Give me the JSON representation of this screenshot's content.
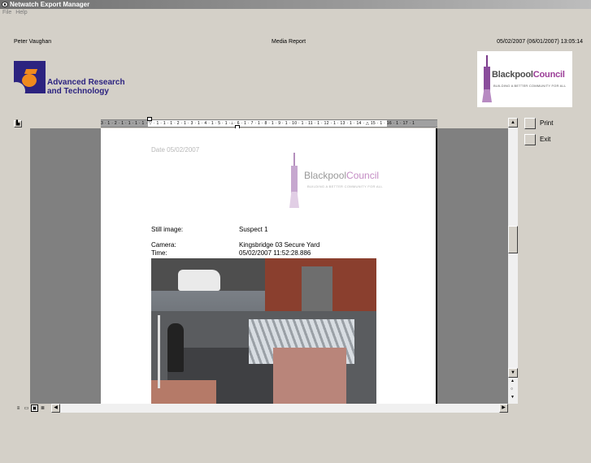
{
  "window": {
    "title": "Netwatch Export Manager"
  },
  "menu": {
    "file": "File",
    "help": "Help"
  },
  "header": {
    "user": "Peter Vaughan",
    "report_title": "Media Report",
    "datetime": "05/02/2007 (06/01/2007) 13:05:14"
  },
  "logos": {
    "art_line1": "Advanced Research",
    "art_line2": "and Technology",
    "council_name": "Blackpool",
    "council_word": "Council",
    "council_tagline": "BUILDING A BETTER COMMUNITY FOR ALL"
  },
  "ruler": {
    "marks": "3 · 1 · 2 · 1 · 1 · 1 · 1 · ▽ · 1 · 1 · 1 · 2 · 1 · 3 · 1 · 4 · 1 · 5 · 1 ·⊥· 6 · 1 · 7 · 1 · 8 · 1 · 9 · 1 · 10 · 1 · 11 · 1 · 12 · 1 · 13 · 1 · 14 · △ 15 · 1 · 16 · 1 · 17 · 1"
  },
  "report": {
    "date": "Date 05/02/2007",
    "still_image_label": "Still image:",
    "still_image_value": "Suspect 1",
    "camera_label": "Camera:",
    "camera_value": "Kingsbridge 03 Secure Yard",
    "time_label": "Time:",
    "time_value": "05/02/2007 11:52:28.886"
  },
  "actions": {
    "print": "Print",
    "exit": "Exit"
  },
  "colors": {
    "art_blue": "#2c2380",
    "art_orange": "#f08a1e",
    "council_purple": "#9b3d97"
  }
}
